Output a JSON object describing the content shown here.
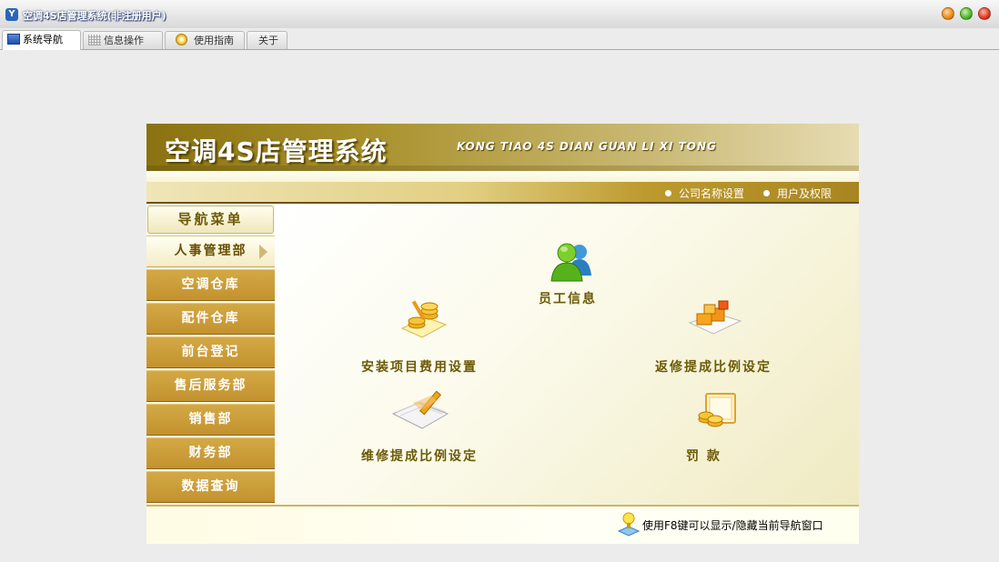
{
  "window": {
    "title": "空调4S店管理系统(非注册用户)"
  },
  "tabs": [
    {
      "label": "系统导航",
      "icon": "monitor-icon"
    },
    {
      "label": "信息操作",
      "icon": "grid-icon"
    },
    {
      "label": "使用指南",
      "icon": "disc-icon"
    },
    {
      "label": "关于"
    }
  ],
  "banner": {
    "title": "空调4S店管理系统",
    "subtitle": "KONG TIAO  4S DIAN GUAN LI XI TONG"
  },
  "top_links": [
    {
      "label": "公司名称设置"
    },
    {
      "label": "用户及权限"
    }
  ],
  "sidebar": {
    "header": "导航菜单",
    "items": [
      {
        "label": "人事管理部",
        "active": true
      },
      {
        "label": "空调仓库"
      },
      {
        "label": "配件仓库"
      },
      {
        "label": "前台登记"
      },
      {
        "label": "售后服务部"
      },
      {
        "label": "销售部"
      },
      {
        "label": "财务部"
      },
      {
        "label": "数据查询"
      }
    ]
  },
  "features": [
    {
      "label": "员工信息",
      "icon": "users-icon"
    },
    {
      "label": "安装项目费用设置",
      "icon": "coins-pen-icon"
    },
    {
      "label": "返修提成比例设定",
      "icon": "boxes-icon"
    },
    {
      "label": "维修提成比例设定",
      "icon": "notepad-pencil-icon"
    },
    {
      "label": "罚        款",
      "icon": "coins-frame-icon"
    }
  ],
  "footer": {
    "hint": "使用F8键可以显示/隐藏当前导航窗口"
  },
  "colors": {
    "banner_dark": "#8a7212",
    "nav_gold": "#c99d38",
    "label_text": "#6b5a06"
  }
}
